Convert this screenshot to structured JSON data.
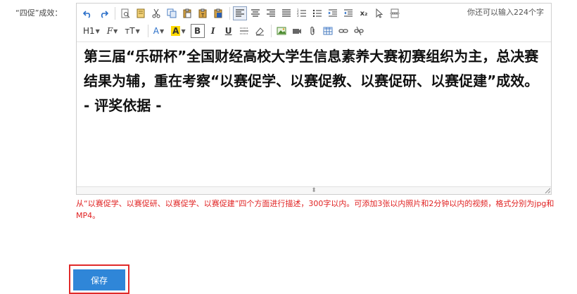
{
  "field_label": "“四促”成效：",
  "editor": {
    "char_count_text": "你还可以输入224个字",
    "content": "第三届“乐研杯”全国财经高校大学生信息素养大赛初赛组织为主，总决赛结果为辅，重在考察“以赛促学、以赛促教、以赛促研、以赛促建”成效。 - 评奖依据 -",
    "toolbar": {
      "heading_label": "H1",
      "font_family_label": "F",
      "font_size_label": "тT",
      "font_color_label": "A",
      "highlight_label": "A",
      "bold_label": "B",
      "italic_label": "I",
      "underline_label": "U",
      "subscript_label": "x₂"
    }
  },
  "hint_text": "从“以赛促学、以赛促研、以赛促学、以赛促建”四个方面进行描述，300字以内。可添加3张以内照片和2分钟以内的视频，格式分别为jpg和MP4。",
  "save_label": "保存",
  "colors": {
    "accent": "#2f86d8",
    "hint": "#e02020",
    "highlight": "#e02a2a"
  }
}
